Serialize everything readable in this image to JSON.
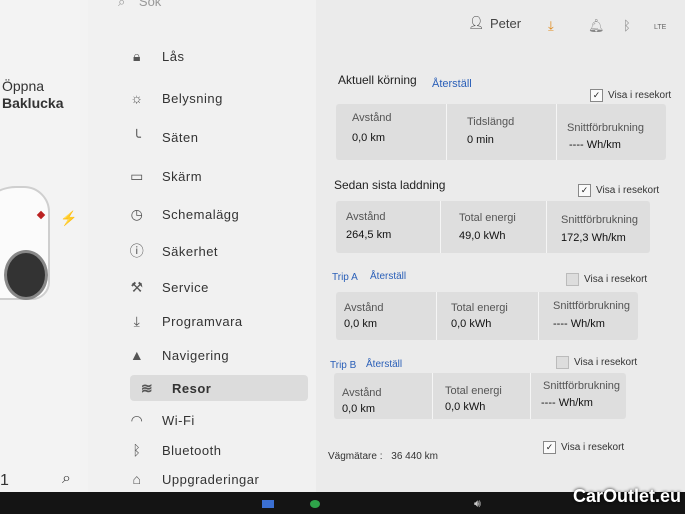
{
  "car": {
    "open_label": "Öppna",
    "trunk_label": "Baklucka",
    "bottom_num": "1"
  },
  "sidebar": {
    "search_placeholder": "Sök",
    "items": [
      {
        "label": "Lås",
        "icon": "lock-icon"
      },
      {
        "label": "Belysning",
        "icon": "light-icon"
      },
      {
        "label": "Säten",
        "icon": "seat-icon"
      },
      {
        "label": "Skärm",
        "icon": "display-icon"
      },
      {
        "label": "Schemalägg",
        "icon": "schedule-icon"
      },
      {
        "label": "Säkerhet",
        "icon": "safety-icon"
      },
      {
        "label": "Service",
        "icon": "wrench-icon"
      },
      {
        "label": "Programvara",
        "icon": "download-icon"
      },
      {
        "label": "Navigering",
        "icon": "navigation-icon"
      },
      {
        "label": "Resor",
        "icon": "trips-icon",
        "active": true
      },
      {
        "label": "Wi-Fi",
        "icon": "wifi-icon"
      },
      {
        "label": "Bluetooth",
        "icon": "bluetooth-icon"
      },
      {
        "label": "Uppgraderingar",
        "icon": "bag-icon"
      }
    ]
  },
  "status": {
    "user": "Peter",
    "signal": "LTE"
  },
  "sections": {
    "current": {
      "title": "Aktuell körning",
      "reset": "Återställ",
      "show": "Visa i resekort",
      "checked": true,
      "labels": [
        "Avstånd",
        "Tidslängd",
        "Snittförbrukning"
      ],
      "values": [
        "0,0 km",
        "0 min",
        "---- Wh/km"
      ]
    },
    "charge": {
      "title": "Sedan sista laddning",
      "show": "Visa i resekort",
      "checked": true,
      "labels": [
        "Avstånd",
        "Total energi",
        "Snittförbrukning"
      ],
      "values": [
        "264,5 km",
        "49,0 kWh",
        "172,3 Wh/km"
      ]
    },
    "tripa": {
      "title": "Trip A",
      "reset": "Återställ",
      "show": "Visa i resekort",
      "checked": false,
      "labels": [
        "Avstånd",
        "Total energi",
        "Snittförbrukning"
      ],
      "values": [
        "0,0 km",
        "0,0 kWh",
        "---- Wh/km"
      ]
    },
    "tripb": {
      "title": "Trip B",
      "reset": "Återställ",
      "show": "Visa i resekort",
      "checked": false,
      "labels": [
        "Avstånd",
        "Total energi",
        "Snittförbrukning"
      ],
      "values": [
        "0,0 km",
        "0,0 kWh",
        "---- Wh/km"
      ]
    }
  },
  "odometer": {
    "label": "Vägmätare",
    "value": "36 440 km",
    "show": "Visa i resekort",
    "checked": true
  },
  "watermark": "CarOutlet.eu",
  "colors": {
    "accent": "#2a5fb8",
    "download": "#e08a1a"
  }
}
